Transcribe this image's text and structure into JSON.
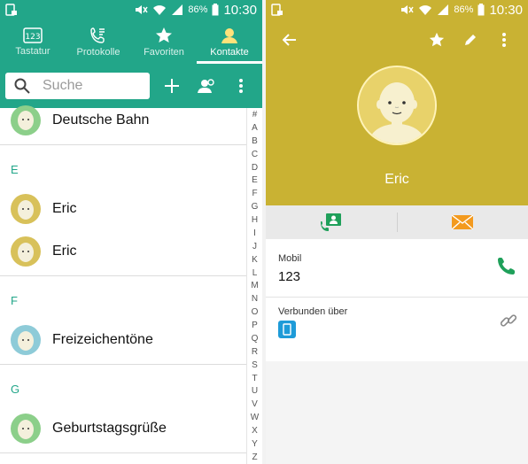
{
  "status_left": {
    "battery_pct": "86%",
    "time": "10:30"
  },
  "status_right": {
    "battery_pct": "86%",
    "time": "10:30"
  },
  "tabs": [
    {
      "label": "Tastatur",
      "icon": "keypad-icon"
    },
    {
      "label": "Protokolle",
      "icon": "call-log-icon"
    },
    {
      "label": "Favoriten",
      "icon": "star-icon"
    },
    {
      "label": "Kontakte",
      "icon": "contact-icon",
      "active": true
    }
  ],
  "search": {
    "placeholder": "Suche"
  },
  "contacts": {
    "rows": [
      {
        "name": "Deutsche Bahn",
        "avatar_color": "#8ccf8a"
      },
      {
        "name": "Eric",
        "avatar_color": "#d8c15a"
      },
      {
        "name": "Eric",
        "avatar_color": "#d8c15a"
      },
      {
        "name": "Freizeichentöne",
        "avatar_color": "#8ecbd8"
      },
      {
        "name": "Geburtstagsgrüße",
        "avatar_color": "#8ccf8a"
      }
    ],
    "sections": [
      "E",
      "F",
      "G"
    ]
  },
  "index_letters": [
    "#",
    "A",
    "B",
    "C",
    "D",
    "E",
    "F",
    "G",
    "H",
    "I",
    "J",
    "K",
    "L",
    "M",
    "N",
    "O",
    "P",
    "Q",
    "R",
    "S",
    "T",
    "U",
    "V",
    "W",
    "X",
    "Y",
    "Z"
  ],
  "detail": {
    "name": "Eric",
    "accent": "#c9b233",
    "phone_label": "Mobil",
    "phone_value": "123",
    "connected_label": "Verbunden über"
  },
  "colors": {
    "left_accent": "#22a689",
    "call_green": "#1fa05a",
    "mail_orange": "#f39a1e"
  }
}
